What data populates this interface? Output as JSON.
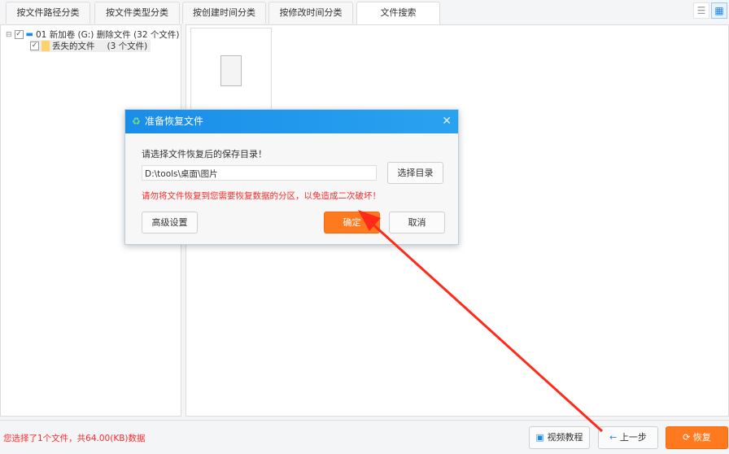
{
  "tabs": [
    "按文件路径分类",
    "按文件类型分类",
    "按创建时间分类",
    "按修改时间分类",
    "文件搜索"
  ],
  "view_icons": [
    "list-view-icon",
    "grid-view-icon"
  ],
  "tree": {
    "root": "01 新加卷 (G:) 删除文件 (32 个文件)",
    "child": "丢失的文件",
    "child_count": "(3 个文件)"
  },
  "dialog": {
    "title": "准备恢复文件",
    "prompt": "请选择文件恢复后的保存目录！",
    "path": "D:\\tools\\桌面\\图片",
    "browse": "选择目录",
    "warning": "请勿将文件恢复到您需要恢复数据的分区，以免造成二次破坏！",
    "advanced": "高级设置",
    "ok": "确定",
    "cancel": "取消"
  },
  "status": "您选择了1个文件，共64.00(KB)数据",
  "buttons": {
    "video": "视频教程",
    "back": "上一步",
    "recover": "恢复"
  },
  "colors": {
    "accent": "#1a8de8",
    "orange": "#ff7a1f",
    "warning": "#ff2a2a"
  }
}
